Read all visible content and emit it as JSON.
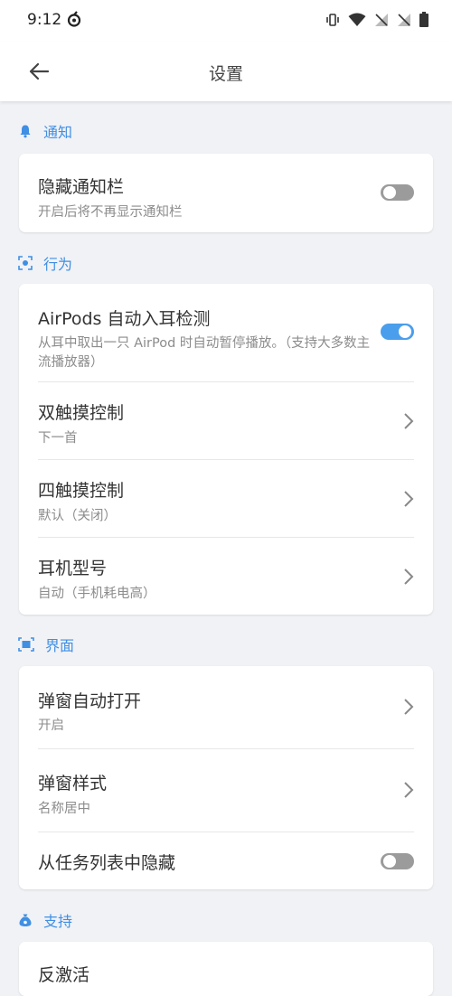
{
  "status_bar": {
    "time": "9:12"
  },
  "app_bar": {
    "title": "设置"
  },
  "colors": {
    "accent": "#3f8fe3",
    "toggle_on": "#4a9eec",
    "toggle_off": "#9b9b9b"
  },
  "sections": {
    "notification": {
      "title": "通知",
      "icon": "bell-icon",
      "items": [
        {
          "title": "隐藏通知栏",
          "subtitle": "开启后将不再显示通知栏",
          "toggle": false
        }
      ]
    },
    "behavior": {
      "title": "行为",
      "icon": "gesture-icon",
      "items": [
        {
          "title": "AirPods 自动入耳检测",
          "subtitle": "从耳中取出一只 AirPod 时自动暂停播放。（支持大多数主流播放器）",
          "toggle": true
        },
        {
          "title": "双触摸控制",
          "subtitle": "下一首"
        },
        {
          "title": "四触摸控制",
          "subtitle": "默认（关闭）"
        },
        {
          "title": "耳机型号",
          "subtitle": "自动（手机耗电高）"
        }
      ]
    },
    "interface": {
      "title": "界面",
      "icon": "window-icon",
      "items": [
        {
          "title": "弹窗自动打开",
          "subtitle": "开启"
        },
        {
          "title": "弹窗样式",
          "subtitle": "名称居中"
        },
        {
          "title": "从任务列表中隐藏",
          "toggle": false
        }
      ]
    },
    "support": {
      "title": "支持",
      "icon": "money-bag-icon",
      "items": [
        {
          "title": "反激活"
        }
      ]
    }
  }
}
